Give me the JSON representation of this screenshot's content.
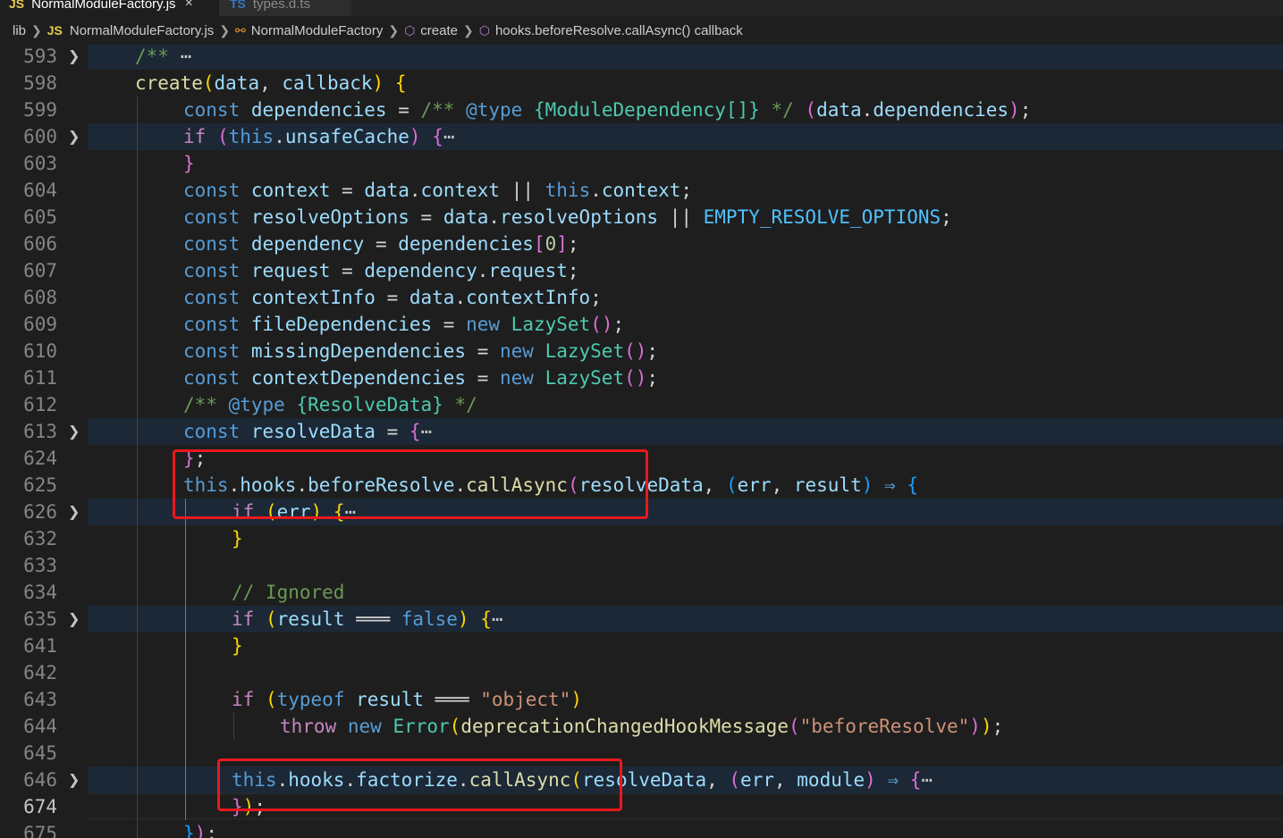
{
  "tabs": [
    {
      "icon": "JS",
      "label": "NormalModuleFactory.js",
      "close": "×"
    },
    {
      "icon": "TS",
      "label": "types.d.ts"
    }
  ],
  "breadcrumb": [
    {
      "icon": "",
      "label": "lib"
    },
    {
      "icon": "JS",
      "label": "NormalModuleFactory.js"
    },
    {
      "icon": "class",
      "label": "NormalModuleFactory"
    },
    {
      "icon": "method",
      "label": "create"
    },
    {
      "icon": "method",
      "label": "hooks.beforeResolve.callAsync() callback"
    }
  ],
  "colors": {
    "keyword": "#569cd6",
    "control": "#c586c0",
    "variable": "#9cdcfe",
    "function": "#dcdcaa",
    "type": "#4ec9b0",
    "string": "#ce9178",
    "comment": "#6a9955",
    "number": "#b5cea8",
    "constant": "#4fc1ff",
    "annotation_box": "#e8191e"
  },
  "lines": [
    {
      "num": "593",
      "fold": true,
      "indent": 0,
      "tokens": [
        [
          "/** ",
          "comment"
        ],
        [
          "⋯",
          "ellipsis"
        ]
      ]
    },
    {
      "num": "598",
      "indent": 0,
      "tokens": [
        [
          "create",
          "function"
        ],
        [
          "(",
          "bracket1"
        ],
        [
          "data",
          "variable"
        ],
        [
          ", ",
          "text"
        ],
        [
          "callback",
          "variable"
        ],
        [
          ")",
          "bracket1"
        ],
        [
          " ",
          "text"
        ],
        [
          "{",
          "bracket1"
        ]
      ]
    },
    {
      "num": "599",
      "indent": 1,
      "tokens": [
        [
          "const ",
          "keyword"
        ],
        [
          "dependencies",
          "variable"
        ],
        [
          " = ",
          "text"
        ],
        [
          "/** ",
          "comment"
        ],
        [
          "@type",
          "keyword"
        ],
        [
          " {ModuleDependency[]} ",
          "type"
        ],
        [
          "*/",
          "comment"
        ],
        [
          " ",
          "text"
        ],
        [
          "(",
          "bracket2"
        ],
        [
          "data",
          "variable"
        ],
        [
          ".",
          "text"
        ],
        [
          "dependencies",
          "variable"
        ],
        [
          ")",
          "bracket2"
        ],
        [
          ";",
          "text"
        ]
      ]
    },
    {
      "num": "600",
      "fold": true,
      "indent": 1,
      "tokens": [
        [
          "if",
          "control"
        ],
        [
          " ",
          "text"
        ],
        [
          "(",
          "bracket2"
        ],
        [
          "this",
          "keyword"
        ],
        [
          ".",
          "text"
        ],
        [
          "unsafeCache",
          "variable"
        ],
        [
          ")",
          "bracket2"
        ],
        [
          " ",
          "text"
        ],
        [
          "{",
          "bracket2"
        ],
        [
          "⋯",
          "ellipsis"
        ]
      ]
    },
    {
      "num": "603",
      "indent": 1,
      "tokens": [
        [
          "}",
          "bracket2"
        ]
      ]
    },
    {
      "num": "604",
      "indent": 1,
      "tokens": [
        [
          "const ",
          "keyword"
        ],
        [
          "context",
          "variable"
        ],
        [
          " = ",
          "text"
        ],
        [
          "data",
          "variable"
        ],
        [
          ".",
          "text"
        ],
        [
          "context",
          "variable"
        ],
        [
          " || ",
          "text"
        ],
        [
          "this",
          "keyword"
        ],
        [
          ".",
          "text"
        ],
        [
          "context",
          "variable"
        ],
        [
          ";",
          "text"
        ]
      ]
    },
    {
      "num": "605",
      "indent": 1,
      "tokens": [
        [
          "const ",
          "keyword"
        ],
        [
          "resolveOptions",
          "variable"
        ],
        [
          " = ",
          "text"
        ],
        [
          "data",
          "variable"
        ],
        [
          ".",
          "text"
        ],
        [
          "resolveOptions",
          "variable"
        ],
        [
          " || ",
          "text"
        ],
        [
          "EMPTY_RESOLVE_OPTIONS",
          "constant"
        ],
        [
          ";",
          "text"
        ]
      ]
    },
    {
      "num": "606",
      "indent": 1,
      "tokens": [
        [
          "const ",
          "keyword"
        ],
        [
          "dependency",
          "variable"
        ],
        [
          " = ",
          "text"
        ],
        [
          "dependencies",
          "variable"
        ],
        [
          "[",
          "bracket2"
        ],
        [
          "0",
          "number"
        ],
        [
          "]",
          "bracket2"
        ],
        [
          ";",
          "text"
        ]
      ]
    },
    {
      "num": "607",
      "indent": 1,
      "tokens": [
        [
          "const ",
          "keyword"
        ],
        [
          "request",
          "variable"
        ],
        [
          " = ",
          "text"
        ],
        [
          "dependency",
          "variable"
        ],
        [
          ".",
          "text"
        ],
        [
          "request",
          "variable"
        ],
        [
          ";",
          "text"
        ]
      ]
    },
    {
      "num": "608",
      "indent": 1,
      "tokens": [
        [
          "const ",
          "keyword"
        ],
        [
          "contextInfo",
          "variable"
        ],
        [
          " = ",
          "text"
        ],
        [
          "data",
          "variable"
        ],
        [
          ".",
          "text"
        ],
        [
          "contextInfo",
          "variable"
        ],
        [
          ";",
          "text"
        ]
      ]
    },
    {
      "num": "609",
      "indent": 1,
      "tokens": [
        [
          "const ",
          "keyword"
        ],
        [
          "fileDependencies",
          "variable"
        ],
        [
          " = ",
          "text"
        ],
        [
          "new ",
          "keyword"
        ],
        [
          "LazySet",
          "type"
        ],
        [
          "()",
          "bracket2"
        ],
        [
          ";",
          "text"
        ]
      ]
    },
    {
      "num": "610",
      "indent": 1,
      "tokens": [
        [
          "const ",
          "keyword"
        ],
        [
          "missingDependencies",
          "variable"
        ],
        [
          " = ",
          "text"
        ],
        [
          "new ",
          "keyword"
        ],
        [
          "LazySet",
          "type"
        ],
        [
          "()",
          "bracket2"
        ],
        [
          ";",
          "text"
        ]
      ]
    },
    {
      "num": "611",
      "indent": 1,
      "tokens": [
        [
          "const ",
          "keyword"
        ],
        [
          "contextDependencies",
          "variable"
        ],
        [
          " = ",
          "text"
        ],
        [
          "new ",
          "keyword"
        ],
        [
          "LazySet",
          "type"
        ],
        [
          "()",
          "bracket2"
        ],
        [
          ";",
          "text"
        ]
      ]
    },
    {
      "num": "612",
      "indent": 1,
      "tokens": [
        [
          "/** ",
          "comment"
        ],
        [
          "@type",
          "keyword"
        ],
        [
          " {ResolveData} ",
          "type"
        ],
        [
          "*/",
          "comment"
        ]
      ]
    },
    {
      "num": "613",
      "fold": true,
      "indent": 1,
      "tokens": [
        [
          "const ",
          "keyword"
        ],
        [
          "resolveData",
          "variable"
        ],
        [
          " = ",
          "text"
        ],
        [
          "{",
          "bracket2"
        ],
        [
          "⋯",
          "ellipsis"
        ]
      ]
    },
    {
      "num": "624",
      "indent": 1,
      "tokens": [
        [
          "}",
          "bracket2"
        ],
        [
          ";",
          "text"
        ]
      ]
    },
    {
      "num": "625",
      "indent": 1,
      "tokens": [
        [
          "this",
          "keyword"
        ],
        [
          ".",
          "text"
        ],
        [
          "hooks",
          "variable"
        ],
        [
          ".",
          "text"
        ],
        [
          "beforeResolve",
          "variable"
        ],
        [
          ".",
          "text"
        ],
        [
          "callAsync",
          "function"
        ],
        [
          "(",
          "bracket2"
        ],
        [
          "resolveData",
          "variable"
        ],
        [
          ", ",
          "text"
        ],
        [
          "(",
          "bracket3"
        ],
        [
          "err",
          "variable"
        ],
        [
          ", ",
          "text"
        ],
        [
          "result",
          "variable"
        ],
        [
          ")",
          "bracket3"
        ],
        [
          " ⇒ ",
          "keyword"
        ],
        [
          "{",
          "bracket3"
        ]
      ]
    },
    {
      "num": "626",
      "fold": true,
      "indent": 2,
      "tokens": [
        [
          "if",
          "control"
        ],
        [
          " ",
          "text"
        ],
        [
          "(",
          "bracket1"
        ],
        [
          "err",
          "variable"
        ],
        [
          ")",
          "bracket1"
        ],
        [
          " ",
          "text"
        ],
        [
          "{",
          "bracket1"
        ],
        [
          "⋯",
          "ellipsis"
        ]
      ]
    },
    {
      "num": "632",
      "indent": 2,
      "tokens": [
        [
          "}",
          "bracket1"
        ]
      ]
    },
    {
      "num": "633",
      "indent": 2,
      "tokens": []
    },
    {
      "num": "634",
      "indent": 2,
      "tokens": [
        [
          "// Ignored",
          "comment"
        ]
      ]
    },
    {
      "num": "635",
      "fold": true,
      "indent": 2,
      "tokens": [
        [
          "if",
          "control"
        ],
        [
          " ",
          "text"
        ],
        [
          "(",
          "bracket1"
        ],
        [
          "result",
          "variable"
        ],
        [
          " ═══ ",
          "text"
        ],
        [
          "false",
          "keyword"
        ],
        [
          ")",
          "bracket1"
        ],
        [
          " ",
          "text"
        ],
        [
          "{",
          "bracket1"
        ],
        [
          "⋯",
          "ellipsis"
        ]
      ]
    },
    {
      "num": "641",
      "indent": 2,
      "tokens": [
        [
          "}",
          "bracket1"
        ]
      ]
    },
    {
      "num": "642",
      "indent": 2,
      "tokens": []
    },
    {
      "num": "643",
      "indent": 2,
      "tokens": [
        [
          "if",
          "control"
        ],
        [
          " ",
          "text"
        ],
        [
          "(",
          "bracket1"
        ],
        [
          "typeof ",
          "keyword"
        ],
        [
          "result",
          "variable"
        ],
        [
          " ═══ ",
          "text"
        ],
        [
          "\"object\"",
          "string"
        ],
        [
          ")",
          "bracket1"
        ]
      ]
    },
    {
      "num": "644",
      "indent": 3,
      "tokens": [
        [
          "throw ",
          "control"
        ],
        [
          "new ",
          "keyword"
        ],
        [
          "Error",
          "type"
        ],
        [
          "(",
          "bracket1"
        ],
        [
          "deprecationChangedHookMessage",
          "function"
        ],
        [
          "(",
          "bracket2"
        ],
        [
          "\"beforeResolve\"",
          "string"
        ],
        [
          ")",
          "bracket2"
        ],
        [
          ")",
          "bracket1"
        ],
        [
          ";",
          "text"
        ]
      ]
    },
    {
      "num": "645",
      "indent": 2,
      "tokens": []
    },
    {
      "num": "646",
      "fold": true,
      "indent": 2,
      "tokens": [
        [
          "this",
          "keyword"
        ],
        [
          ".",
          "text"
        ],
        [
          "hooks",
          "variable"
        ],
        [
          ".",
          "text"
        ],
        [
          "factorize",
          "variable"
        ],
        [
          ".",
          "text"
        ],
        [
          "callAsync",
          "function"
        ],
        [
          "(",
          "bracket1"
        ],
        [
          "resolveData",
          "variable"
        ],
        [
          ", ",
          "text"
        ],
        [
          "(",
          "bracket2"
        ],
        [
          "err",
          "variable"
        ],
        [
          ", ",
          "text"
        ],
        [
          "module",
          "variable"
        ],
        [
          ")",
          "bracket2"
        ],
        [
          " ⇒ ",
          "keyword"
        ],
        [
          "{",
          "bracket2"
        ],
        [
          "⋯",
          "ellipsis"
        ]
      ]
    },
    {
      "num": "674",
      "current": true,
      "indent": 2,
      "tokens": [
        [
          "}",
          "bracket2"
        ],
        [
          ")",
          "bracket1"
        ],
        [
          ";",
          "text"
        ]
      ]
    },
    {
      "num": "675",
      "indent": 1,
      "tokens": [
        [
          "}",
          "bracket3"
        ],
        [
          ")",
          "bracket2"
        ],
        [
          ";",
          "text"
        ]
      ]
    }
  ]
}
